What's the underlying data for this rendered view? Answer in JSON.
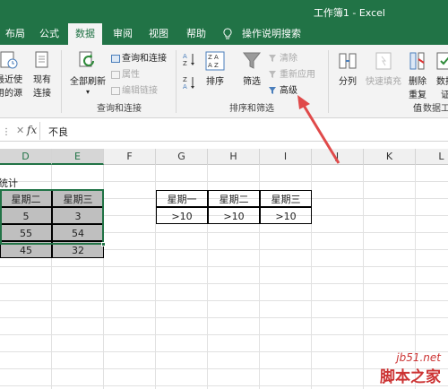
{
  "window": {
    "title": "工作簿1 - Excel"
  },
  "tabs": [
    {
      "label": "布局",
      "active": false
    },
    {
      "label": "公式",
      "active": false
    },
    {
      "label": "数据",
      "active": true
    },
    {
      "label": "审阅",
      "active": false
    },
    {
      "label": "视图",
      "active": false
    },
    {
      "label": "帮助",
      "active": false
    }
  ],
  "tell_me": {
    "placeholder": "操作说明搜索",
    "icon": "lightbulb-icon"
  },
  "ribbon": {
    "get_data": {
      "recent_sources": "最近使\n用的源",
      "existing": "现有\n连接"
    },
    "queries": {
      "refresh_all": "全部刷新",
      "queries_connections": "查询和连接",
      "properties": "属性",
      "edit_links": "编辑链接",
      "group_label": "查询和连接"
    },
    "sort_filter": {
      "sort": "排序",
      "filter": "筛选",
      "clear": "清除",
      "reapply": "重新应用",
      "advanced": "高级",
      "group_label": "排序和筛选"
    },
    "data_tools": {
      "text_to_columns": "分列",
      "flash_fill": "快速填充",
      "remove_duplicates": "删除\n重复值",
      "validation": "数据\n证",
      "group_label": "数据工"
    }
  },
  "formula_bar": {
    "fx": "fx",
    "value": "不良"
  },
  "columns": [
    "D",
    "E",
    "F",
    "G",
    "H",
    "I",
    "J",
    "K",
    "L"
  ],
  "sheet": {
    "title_cell": "统计",
    "data_headers": [
      "星期二",
      "星期三"
    ],
    "data_rows": [
      [
        "5",
        "3"
      ],
      [
        "55",
        "54"
      ],
      [
        "45",
        "32"
      ]
    ],
    "criteria_headers": [
      "星期一",
      "星期二",
      "星期三"
    ],
    "criteria_values": [
      ">10",
      ">10",
      ">10"
    ]
  },
  "colors": {
    "excel_green": "#217346",
    "arrow": "#e04a4a"
  },
  "watermark": {
    "domain": "jb51.net",
    "name": "脚本之家"
  }
}
